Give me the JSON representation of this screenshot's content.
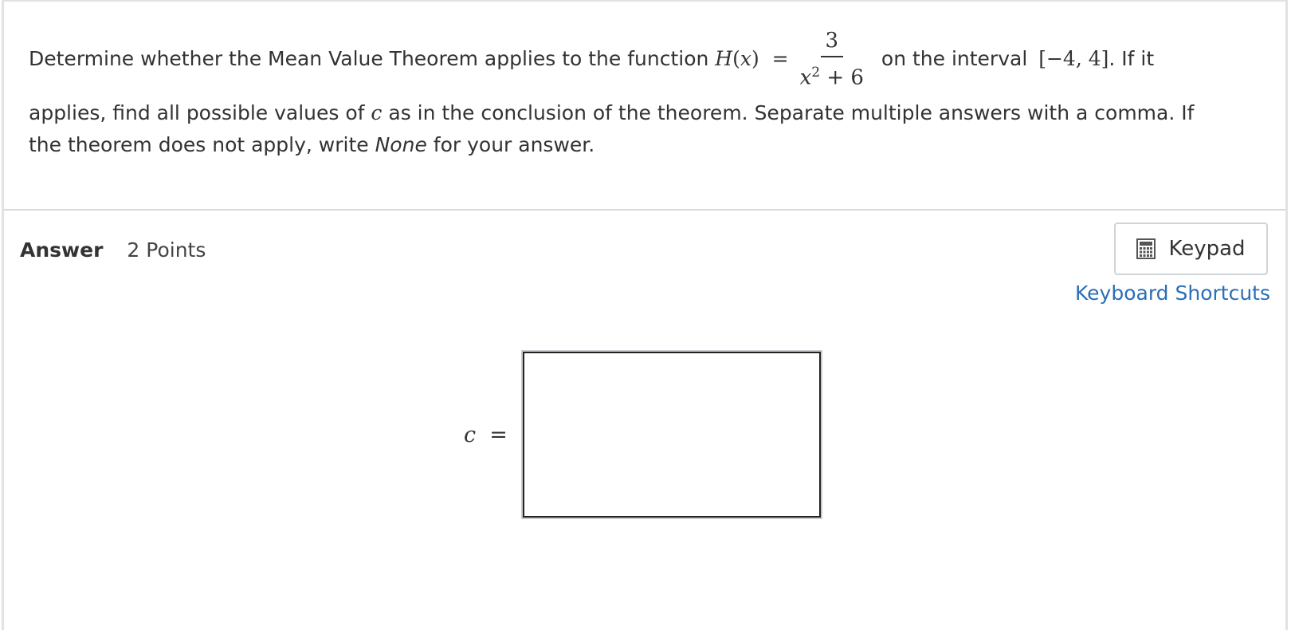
{
  "question": {
    "prefix": "Determine whether the Mean Value Theorem applies to the function ",
    "func_name": "H",
    "func_var": "x",
    "equals": "=",
    "numerator": "3",
    "denominator_var": "x",
    "denominator_exp": "2",
    "denominator_rest": " + 6",
    "interval_prefix": " on the interval ",
    "interval": "[−4, 4]",
    "interval_suffix": ". If it",
    "line2_a": "applies, find all possible values of ",
    "line2_var": "c",
    "line2_b": " as in the conclusion of the theorem. Separate multiple answers with a comma. If",
    "line3_a": "the theorem does not apply, write ",
    "line3_none": "None",
    "line3_b": " for your answer."
  },
  "answer": {
    "label": "Answer",
    "points": "2 Points",
    "variable": "c",
    "equals": "=",
    "input_value": ""
  },
  "toolbar": {
    "keypad_label": "Keypad",
    "keypad_icon": "calculator-icon",
    "shortcuts_label": "Keyboard Shortcuts"
  },
  "colors": {
    "link": "#2a6eb7",
    "text": "#333333",
    "border": "#d9d9d9"
  }
}
